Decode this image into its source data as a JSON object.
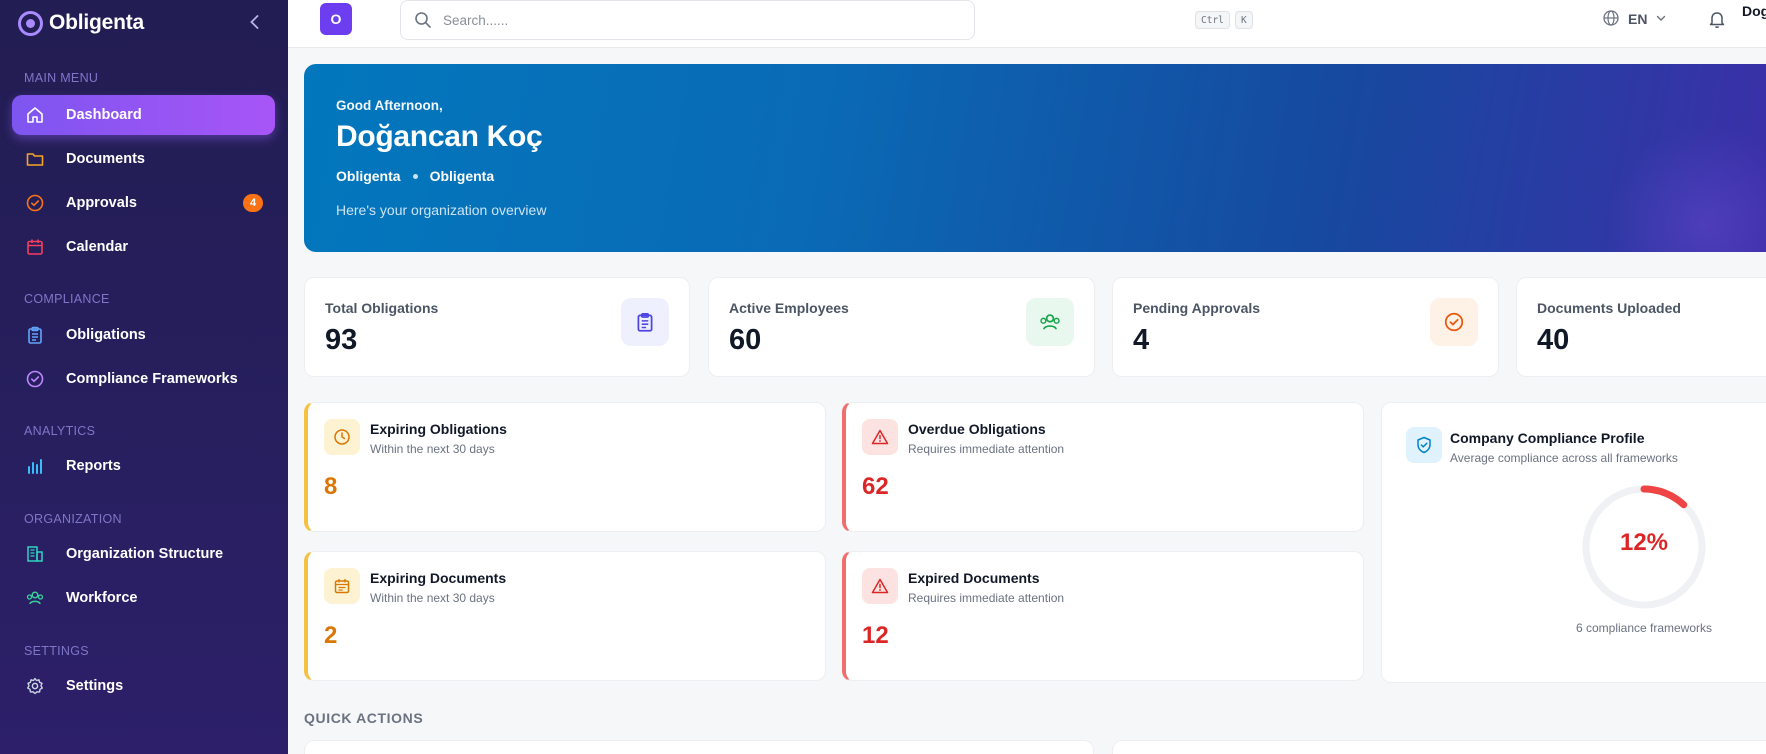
{
  "app": {
    "name": "Obligenta",
    "avatar_letter": "O"
  },
  "sidebar": {
    "sections": {
      "main": "MAIN MENU",
      "compliance": "COMPLIANCE",
      "analytics": "ANALYTICS",
      "organization": "ORGANIZATION",
      "settings": "SETTINGS"
    },
    "items": [
      {
        "label": "Dashboard",
        "icon": "home-icon",
        "active": true
      },
      {
        "label": "Documents",
        "icon": "folder-icon"
      },
      {
        "label": "Approvals",
        "icon": "check-circle-icon",
        "badge": "4"
      },
      {
        "label": "Calendar",
        "icon": "calendar-icon"
      },
      {
        "label": "Obligations",
        "icon": "clipboard-icon"
      },
      {
        "label": "Compliance Frameworks",
        "icon": "check-circle-icon"
      },
      {
        "label": "Reports",
        "icon": "bar-chart-icon"
      },
      {
        "label": "Organization Structure",
        "icon": "building-icon"
      },
      {
        "label": "Workforce",
        "icon": "users-icon"
      },
      {
        "label": "Settings",
        "icon": "gear-icon"
      }
    ]
  },
  "topbar": {
    "search_placeholder": "Search......",
    "shortcut_ctrl": "Ctrl",
    "shortcut_key": "K",
    "language": "EN",
    "user_name": "Dog"
  },
  "hero": {
    "greeting": "Good Afternoon,",
    "name": "Doğancan Koç",
    "org_primary": "Obligenta",
    "org_secondary": "Obligenta",
    "subtitle": "Here's your organization overview"
  },
  "stats": [
    {
      "label": "Total Obligations",
      "value": "93",
      "icon": "clipboard-icon",
      "color": "#4f46e5",
      "bg": "#eef0fd"
    },
    {
      "label": "Active Employees",
      "value": "60",
      "icon": "users-icon",
      "color": "#16a34a",
      "bg": "#e8f8ee"
    },
    {
      "label": "Pending Approvals",
      "value": "4",
      "icon": "check-circle-icon",
      "color": "#ea580c",
      "bg": "#fef1e6"
    },
    {
      "label": "Documents Uploaded",
      "value": "40",
      "icon": "file-icon",
      "color": "#0ea5e9",
      "bg": "#e0f2fe"
    }
  ],
  "alerts": {
    "expiring_obligations": {
      "title": "Expiring Obligations",
      "subtitle": "Within the next 30 days",
      "value": "8"
    },
    "overdue_obligations": {
      "title": "Overdue Obligations",
      "subtitle": "Requires immediate attention",
      "value": "62"
    },
    "expiring_documents": {
      "title": "Expiring Documents",
      "subtitle": "Within the next 30 days",
      "value": "2"
    },
    "expired_documents": {
      "title": "Expired Documents",
      "subtitle": "Requires immediate attention",
      "value": "12"
    }
  },
  "compliance": {
    "title": "Company Compliance Profile",
    "subtitle": "Average compliance across all frameworks",
    "percent_label": "12%",
    "percent": 12,
    "footer": "6 compliance frameworks",
    "color": "#ef4444"
  },
  "quick_actions": {
    "title": "QUICK ACTIONS"
  }
}
